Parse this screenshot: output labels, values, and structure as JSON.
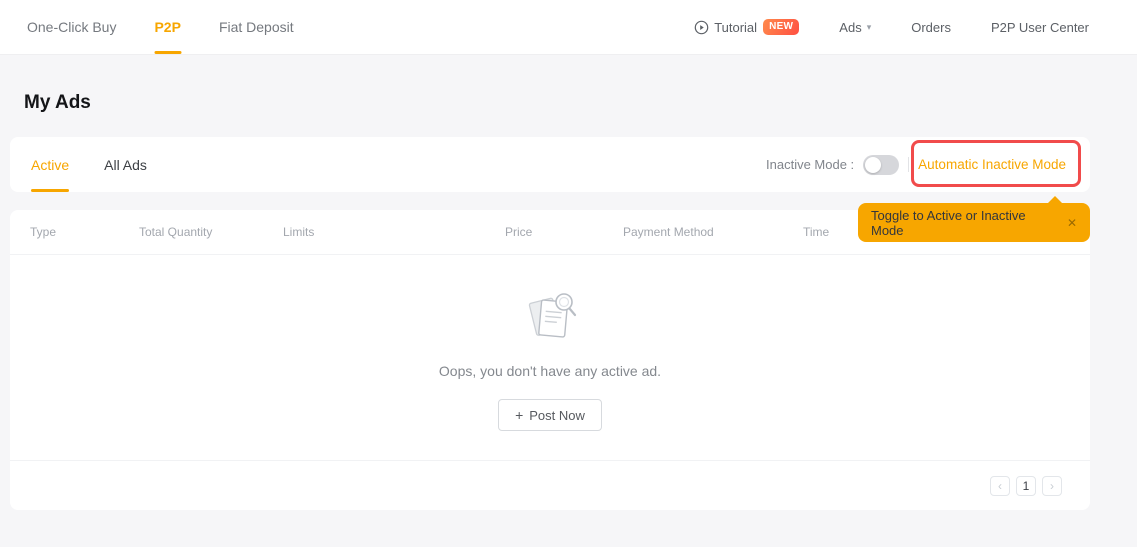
{
  "topnav": {
    "left": [
      {
        "label": "One-Click Buy"
      },
      {
        "label": "P2P",
        "active": true
      },
      {
        "label": "Fiat Deposit"
      }
    ],
    "right": {
      "tutorial": "Tutorial",
      "new_badge": "NEW",
      "ads": "Ads",
      "orders": "Orders",
      "user_center": "P2P User Center"
    }
  },
  "page": {
    "title": "My Ads"
  },
  "tabs": {
    "items": [
      {
        "label": "Active",
        "active": true
      },
      {
        "label": "All Ads",
        "active": false
      }
    ]
  },
  "mode_controls": {
    "label": "Inactive Mode :",
    "toggle_state": "off",
    "link": "Automatic Inactive Mode"
  },
  "tooltip": {
    "text": "Toggle to Active or Inactive Mode"
  },
  "table": {
    "headers": [
      "Type",
      "Total Quantity",
      "Limits",
      "Price",
      "Payment Method",
      "Time"
    ],
    "rows": []
  },
  "empty_state": {
    "message": "Oops, you don't have any active ad.",
    "post_button": "Post Now"
  },
  "pagination": {
    "current": "1"
  },
  "icons": {
    "caret_down": "▾",
    "close": "✕",
    "prev": "‹",
    "next": "›",
    "plus": "+"
  },
  "colors": {
    "accent": "#f7a600",
    "annotation_red": "#f14b4b",
    "tooltip_bg": "#f7a600",
    "badge_gradient_start": "#ff8a4c",
    "badge_gradient_end": "#ff4f42"
  }
}
